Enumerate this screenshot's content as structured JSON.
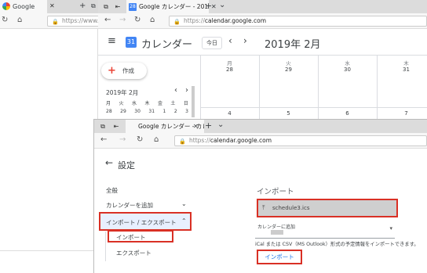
{
  "window1": {
    "tab_title": "Google",
    "tab_close": "✕",
    "new_tab": "+",
    "url": "https://www.g"
  },
  "window2": {
    "tab_buttons": [
      "⧉",
      "⇤"
    ],
    "tab_title": "Google カレンダー - 2019",
    "tab_close": "✕",
    "new_tab": "+",
    "tab_menu": "⌄",
    "url_prefix": "https://",
    "url_domain": "calendar.google.com",
    "calendar": {
      "menu_icon": "≡",
      "logo": "31",
      "app_title": "カレンダー",
      "today": "今日",
      "prev": "‹",
      "next": "›",
      "month_title": "2019年 2月",
      "create": "作成",
      "weekdays": [
        "月",
        "火",
        "水",
        "木"
      ],
      "first_row": [
        "28",
        "29",
        "30",
        "31"
      ],
      "second_row": [
        "4",
        "5",
        "6",
        "7"
      ],
      "mini": {
        "title": "2019年 2月",
        "prev": "‹",
        "next": "›",
        "days": [
          "月",
          "火",
          "水",
          "木",
          "金",
          "土",
          "日"
        ],
        "row1": [
          "28",
          "29",
          "30",
          "31",
          "1",
          "2",
          "3"
        ]
      }
    }
  },
  "window3": {
    "tab_buttons": [
      "⧉",
      "⇤"
    ],
    "tab_title": "Google カレンダー - カレン",
    "tab_close": "✕",
    "new_tab": "+",
    "tab_menu": "⌄",
    "url_prefix": "https://",
    "url_domain": "calendar.google.com",
    "settings": {
      "back": "←",
      "title": "設定",
      "menu": {
        "general": "全般",
        "add_calendar": "カレンダーを追加",
        "add_calendar_chevron": "⌄",
        "import_export": "インポート / エクスポート",
        "import_export_chevron": "⌃",
        "import": "インポート",
        "export": "エクスポート"
      },
      "import_section": {
        "title": "インポート",
        "file_name": "schedule3.ics",
        "upload_icon": "⤒",
        "add_to_label": "カレンダーに追加",
        "dropdown_arrow": "▾",
        "note": "iCal または CSV（MS Outlook）形式の予定情報をインポートできます。",
        "import_button": "インポート"
      }
    }
  },
  "colors": {
    "accent_blue": "#1a73e8",
    "highlight_red": "#d93025",
    "selected_bg": "#e8f0fe"
  }
}
